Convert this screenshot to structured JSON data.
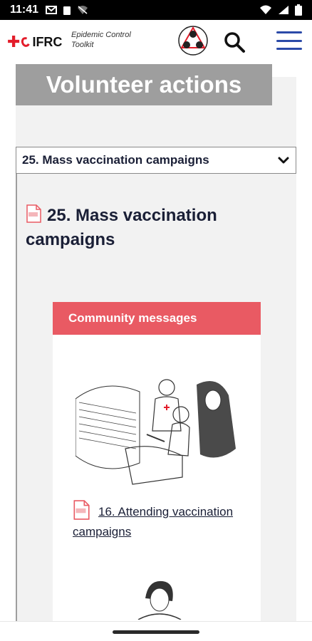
{
  "status_bar": {
    "time": "11:41"
  },
  "header": {
    "logo_text": "IFRC",
    "tagline_line1": "Epidemic Control",
    "tagline_line2": "Toolkit"
  },
  "page": {
    "title": "Volunteer actions",
    "select_value": "25. Mass vaccination campaigns",
    "section_heading": "25. Mass vaccination campaigns"
  },
  "card": {
    "header": "Community messages",
    "link_text": "16. Attending vaccination campaigns"
  },
  "colors": {
    "brand_red": "#e31d2b",
    "card_header": "#e95a63",
    "title_banner": "#9e9e9e",
    "menu_blue": "#2b4aa8",
    "text_dark": "#1a1f36"
  },
  "icons": [
    "pdf-icon",
    "search-icon",
    "menu-icon",
    "chevron-down-icon",
    "wifi-icon",
    "signal-icon",
    "battery-icon"
  ]
}
